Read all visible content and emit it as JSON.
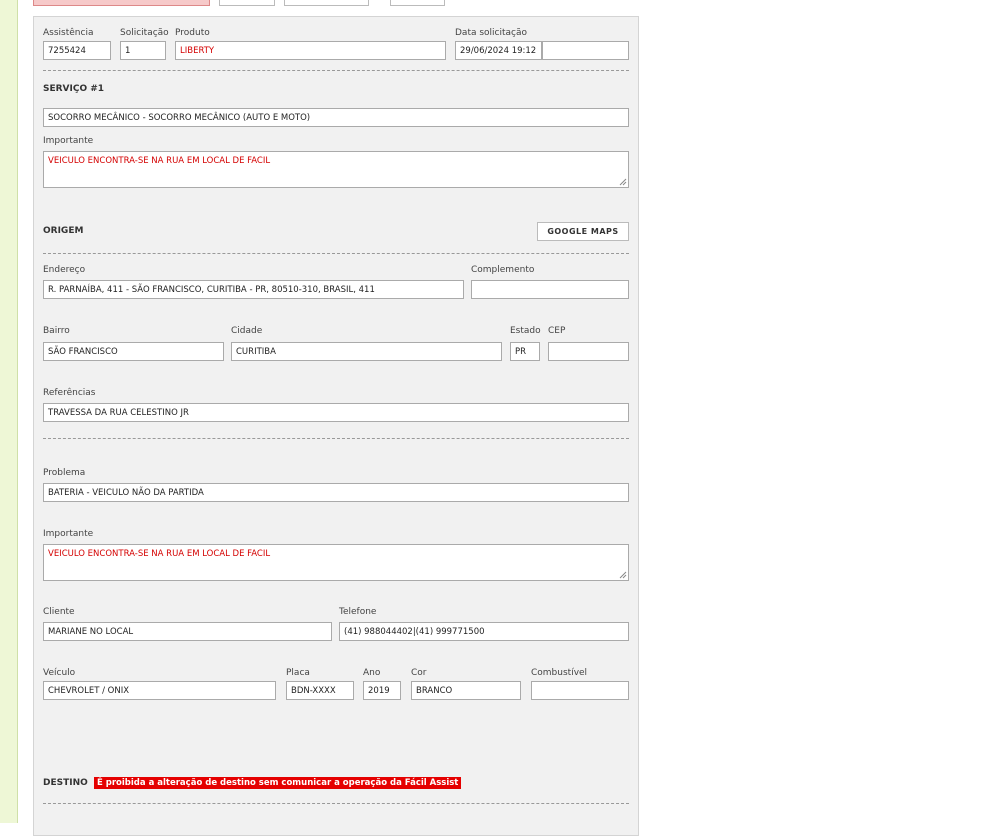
{
  "form": {
    "assistencia": {
      "label": "Assistência",
      "value": "7255424"
    },
    "solicitacao": {
      "label": "Solicitação",
      "value": "1"
    },
    "produto": {
      "label": "Produto",
      "value": "LIBERTY"
    },
    "data_solicitacao": {
      "label": "Data solicitação",
      "value": "29/06/2024 19:12",
      "extra_value": ""
    }
  },
  "servico": {
    "title": "SERVIÇO #1",
    "servico_value": "SOCORRO MECÂNICO - SOCORRO MECÂNICO (AUTO E MOTO)",
    "importante_label": "Importante",
    "importante_value": "VEICULO ENCONTRA-SE NA RUA EM LOCAL DE FACIL"
  },
  "origem": {
    "title": "ORIGEM",
    "google_maps_label": "GOOGLE MAPS",
    "endereco": {
      "label": "Endereço",
      "value": "R. PARNAÍBA, 411 - SÃO FRANCISCO, CURITIBA - PR, 80510-310, BRASIL, 411"
    },
    "complemento": {
      "label": "Complemento",
      "value": ""
    },
    "bairro": {
      "label": "Bairro",
      "value": "SÃO FRANCISCO"
    },
    "cidade": {
      "label": "Cidade",
      "value": "CURITIBA"
    },
    "estado": {
      "label": "Estado",
      "value": "PR"
    },
    "cep": {
      "label": "CEP",
      "value": ""
    },
    "referencias": {
      "label": "Referências",
      "value": "TRAVESSA DA RUA CELESTINO JR"
    }
  },
  "problema": {
    "problema": {
      "label": "Problema",
      "value": "BATERIA - VEICULO NÃO DA PARTIDA"
    },
    "importante": {
      "label": "Importante",
      "value": "VEICULO ENCONTRA-SE NA RUA EM LOCAL DE FACIL"
    },
    "cliente": {
      "label": "Cliente",
      "value": "MARIANE NO LOCAL"
    },
    "telefone": {
      "label": "Telefone",
      "value": "(41) 988044402|(41) 999771500"
    },
    "veiculo": {
      "label": "Veículo",
      "value": "CHEVROLET / ONIX"
    },
    "placa": {
      "label": "Placa",
      "value": "BDN-XXXX"
    },
    "ano": {
      "label": "Ano",
      "value": "2019"
    },
    "cor": {
      "label": "Cor",
      "value": "BRANCO"
    },
    "combustivel": {
      "label": "Combustível",
      "value": ""
    }
  },
  "destino": {
    "title": "DESTINO",
    "warning": "É proibida a alteração de destino sem comunicar a operação da Fácil Assist"
  },
  "colors": {
    "accent_red": "#e50000",
    "text_red": "#d40000",
    "side_strip": "#eef7d6"
  }
}
